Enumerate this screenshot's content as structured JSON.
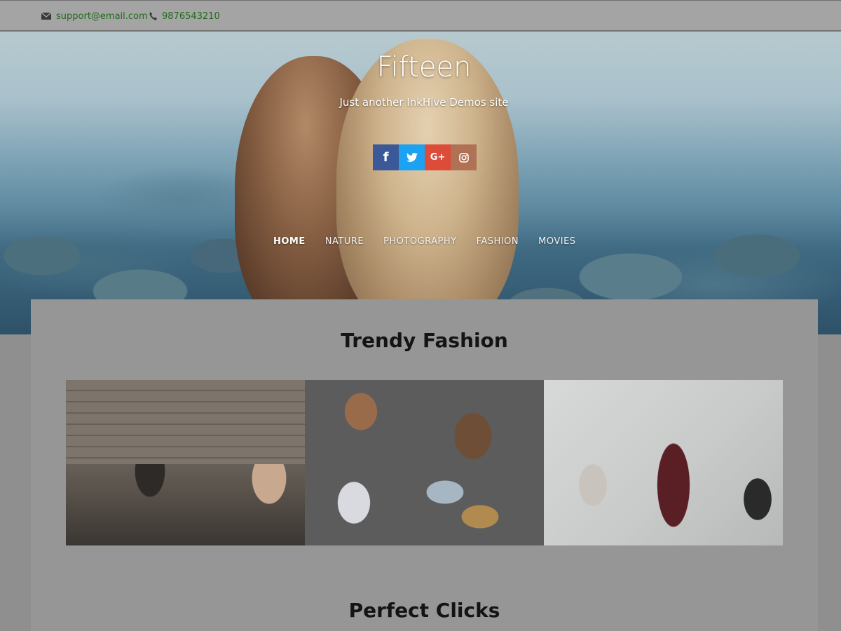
{
  "topbar": {
    "email": "support@email.com",
    "phone": "9876543210"
  },
  "hero": {
    "site_title": "Fifteen",
    "tagline": "Just another InkHive Demos site",
    "social": [
      {
        "name": "facebook",
        "glyph": "f",
        "color": "#3b5998"
      },
      {
        "name": "twitter",
        "glyph": "twitter-bird",
        "color": "#1da1f2"
      },
      {
        "name": "google-plus",
        "glyph": "G+",
        "color": "#dd4b39"
      },
      {
        "name": "instagram",
        "glyph": "instagram-camera",
        "color": "#b07155"
      }
    ],
    "nav": [
      "HOME",
      "NATURE",
      "PHOTOGRAPHY",
      "FASHION",
      "MOVIES"
    ]
  },
  "sections": [
    {
      "title": "Trendy Fashion"
    },
    {
      "title": "Perfect Clicks"
    }
  ],
  "colors": {
    "contact_text": "#1f6b1a",
    "page_background": "#8f8f8f",
    "card_background": "#969696"
  }
}
